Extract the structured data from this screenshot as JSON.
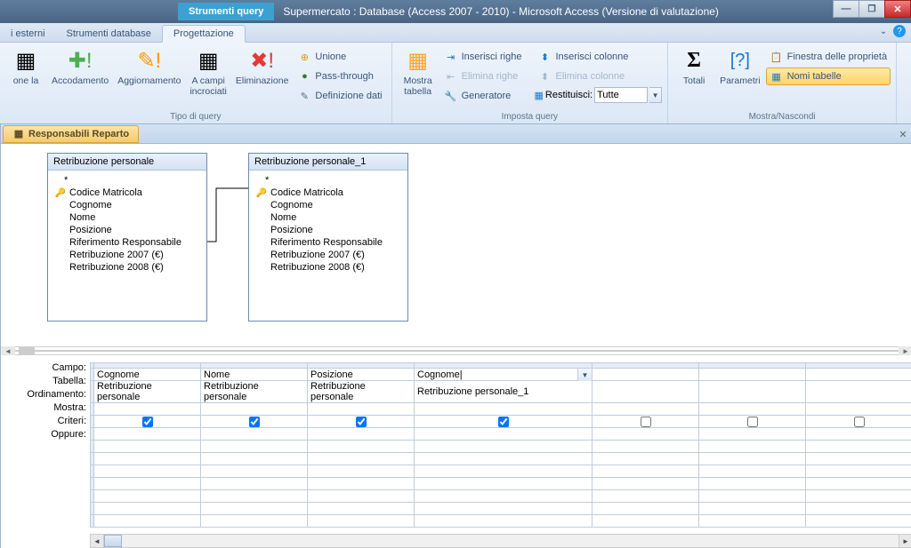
{
  "titlebar": {
    "context_tab": "Strumenti query",
    "title": "Supermercato : Database (Access 2007 - 2010)  -  Microsoft Access (Versione di valutazione)"
  },
  "ribbon_tabs": {
    "t0": "i esterni",
    "t1": "Strumenti database",
    "t2": "Progettazione"
  },
  "ribbon": {
    "g1": {
      "b1": "one\nla",
      "b2": "Accodamento",
      "b3": "Aggiornamento",
      "b4": "A campi\nincrociati",
      "b5": "Eliminazione",
      "small1": "Unione",
      "small2": "Pass-through",
      "small3": "Definizione dati",
      "label": "Tipo di query"
    },
    "g2": {
      "b1": "Mostra\ntabella",
      "s1": "Inserisci righe",
      "s2": "Elimina righe",
      "s3": "Generatore",
      "s4": "Inserisci colonne",
      "s5": "Elimina colonne",
      "s6": "Restituisci:",
      "combo": "Tutte",
      "label": "Imposta query"
    },
    "g3": {
      "b1": "Totali",
      "b2": "Parametri",
      "s1": "Finestra delle proprietà",
      "s2": "Nomi tabelle",
      "label": "Mostra/Nascondi"
    }
  },
  "doc_tab": "Responsabili Reparto",
  "tables": {
    "t1": {
      "title": "Retribuzione personale",
      "fields": [
        "Codice Matricola",
        "Cognome",
        "Nome",
        "Posizione",
        "Riferimento Responsabile",
        "Retribuzione 2007 (€)",
        "Retribuzione 2008 (€)"
      ]
    },
    "t2": {
      "title": "Retribuzione personale_1",
      "fields": [
        "Codice Matricola",
        "Cognome",
        "Nome",
        "Posizione",
        "Riferimento Responsabile",
        "Retribuzione 2007 (€)",
        "Retribuzione 2008 (€)"
      ]
    }
  },
  "qbe": {
    "labels": {
      "campo": "Campo:",
      "tabella": "Tabella:",
      "ordinamento": "Ordinamento:",
      "mostra": "Mostra:",
      "criteri": "Criteri:",
      "oppure": "Oppure:"
    },
    "cols": [
      {
        "campo": "Cognome",
        "tabella": "Retribuzione personale",
        "mostra": true
      },
      {
        "campo": "Nome",
        "tabella": "Retribuzione personale",
        "mostra": true
      },
      {
        "campo": "Posizione",
        "tabella": "Retribuzione personale",
        "mostra": true
      },
      {
        "campo": "Cognome|",
        "tabella": "Retribuzione personale_1",
        "mostra": true,
        "active": true
      },
      {
        "campo": "",
        "tabella": "",
        "mostra": false
      },
      {
        "campo": "",
        "tabella": "",
        "mostra": false
      },
      {
        "campo": "",
        "tabella": "",
        "mostra": false
      }
    ]
  }
}
